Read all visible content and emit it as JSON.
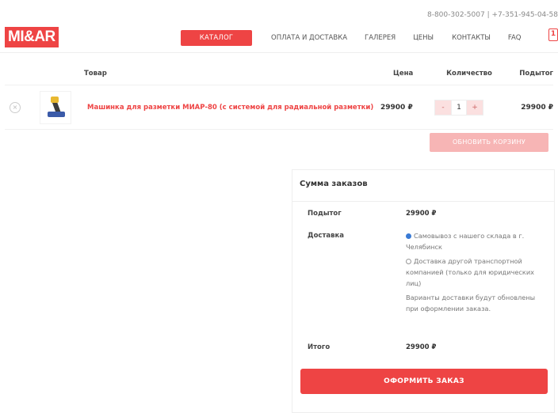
{
  "topbar": {
    "contacts": "8-800-302-5007 | +7-351-945-04-58"
  },
  "logo": {
    "text": "MI&AR"
  },
  "nav": {
    "catalog": "КАТАЛОГ",
    "items": [
      "ОПЛАТА И ДОСТАВКА",
      "ГАЛЕРЕЯ",
      "ЦЕНЫ",
      "КОНТАКТЫ",
      "FAQ"
    ]
  },
  "cart": {
    "count": "1"
  },
  "table": {
    "headers": {
      "product": "Товар",
      "price": "Цена",
      "qty": "Количество",
      "subtotal": "Подытог"
    },
    "rows": [
      {
        "remove": "×",
        "name": "Машинка для разметки МИАР-80 (с системой для радиальной разметки)",
        "price": "29900 ₽",
        "qty": "1",
        "minus": "-",
        "plus": "+",
        "subtotal": "29900 ₽"
      }
    ]
  },
  "update_button": "ОБНОВИТЬ КОРЗИНУ",
  "totals": {
    "title": "Сумма заказов",
    "subtotal_label": "Подытог",
    "subtotal_value": "29900 ₽",
    "shipping_label": "Доставка",
    "options": [
      {
        "label": "Самовывоз с нашего склада в г. Челябинск",
        "selected": true
      },
      {
        "label": "Доставка другой транспортной компанией (только для юридических лиц)",
        "selected": false
      }
    ],
    "shipping_note": "Варианты доставки будут обновлены при оформлении заказа.",
    "total_label": "Итого",
    "total_value": "29900 ₽",
    "checkout_button": "ОФОРМИТЬ ЗАКАЗ"
  },
  "colors": {
    "accent": "#ee4444",
    "accent_light": "#f7b5b5",
    "radio": "#3a7bd5"
  }
}
